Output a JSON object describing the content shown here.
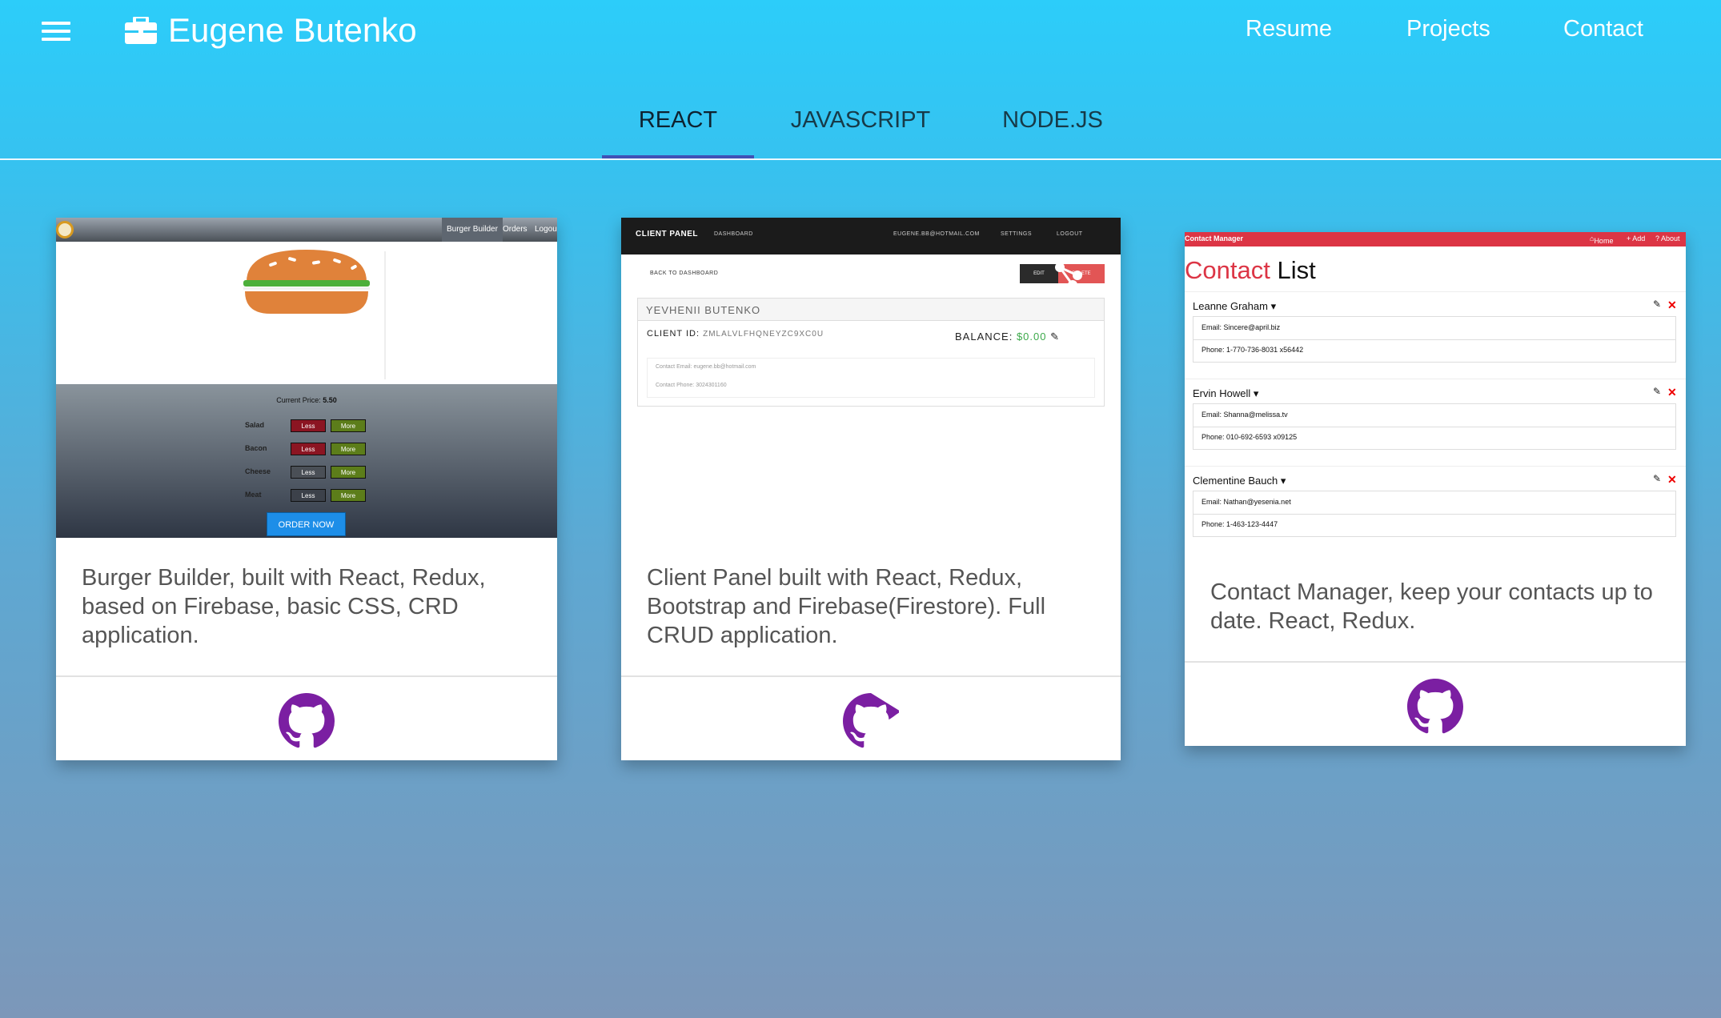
{
  "header": {
    "brand": "Eugene Butenko",
    "nav": [
      "Resume",
      "Projects",
      "Contact"
    ]
  },
  "tabs": [
    {
      "label": "REACT",
      "active": true
    },
    {
      "label": "JAVASCRIPT",
      "active": false
    },
    {
      "label": "NODE.JS",
      "active": false
    }
  ],
  "colors": {
    "tab_indicator": "#3f51b5",
    "github_icon": "#7b1fa2"
  },
  "projects": [
    {
      "description": "Burger Builder, built with React, Redux, based on Firebase, basic CSS, CRD application.",
      "link_icon": "github-icon",
      "screenshot": {
        "nav": [
          "Burger Builder",
          "Orders",
          "Logou"
        ],
        "price_label": "Current Price:",
        "price_value": "5.50",
        "ingredients": [
          "Salad",
          "Bacon",
          "Cheese",
          "Meat"
        ],
        "less_label": "Less",
        "more_label": "More",
        "order_label": "ORDER NOW"
      }
    },
    {
      "description": "Client Panel built with React, Redux, Bootstrap and Firebase(Firestore). Full CRUD application.",
      "link_icon": "github-icon",
      "screenshot": {
        "title": "CLIENT PANEL",
        "nav_dashboard": "DASHBOARD",
        "nav_email": "EUGENE.BB@HOTMAIL.COM",
        "nav_settings": "SETTINGS",
        "nav_logout": "LOGOUT",
        "back_label": "BACK TO DASHBOARD",
        "edit_label": "EDIT",
        "delete_label": "DELETE",
        "client_name": "YEVHENII BUTENKO",
        "client_id_label": "CLIENT ID:",
        "client_id": "ZMLALVLFHQNEYZC9XC0U",
        "balance_label": "BALANCE:",
        "balance_value": "$0.00",
        "contact_email": "Contact Email: eugene.bb@hotmail.com",
        "contact_phone": "Contact Phone: 3024301160"
      }
    },
    {
      "description": "Contact Manager, keep your contacts up to date. React, Redux.",
      "link_icon": "github-icon",
      "screenshot": {
        "brand": "Contact Manager",
        "nav": [
          "Home",
          "+ Add",
          "? About"
        ],
        "heading_red": "Contact",
        "heading_dark": "List",
        "contacts": [
          {
            "name": "Leanne Graham",
            "email": "Email: Sincere@april.biz",
            "phone": "Phone: 1-770-736-8031 x56442"
          },
          {
            "name": "Ervin Howell",
            "email": "Email: Shanna@melissa.tv",
            "phone": "Phone: 010-692-6593 x09125"
          },
          {
            "name": "Clementine Bauch",
            "email": "Email: Nathan@yesenia.net",
            "phone": "Phone: 1-463-123-4447"
          }
        ]
      }
    }
  ]
}
